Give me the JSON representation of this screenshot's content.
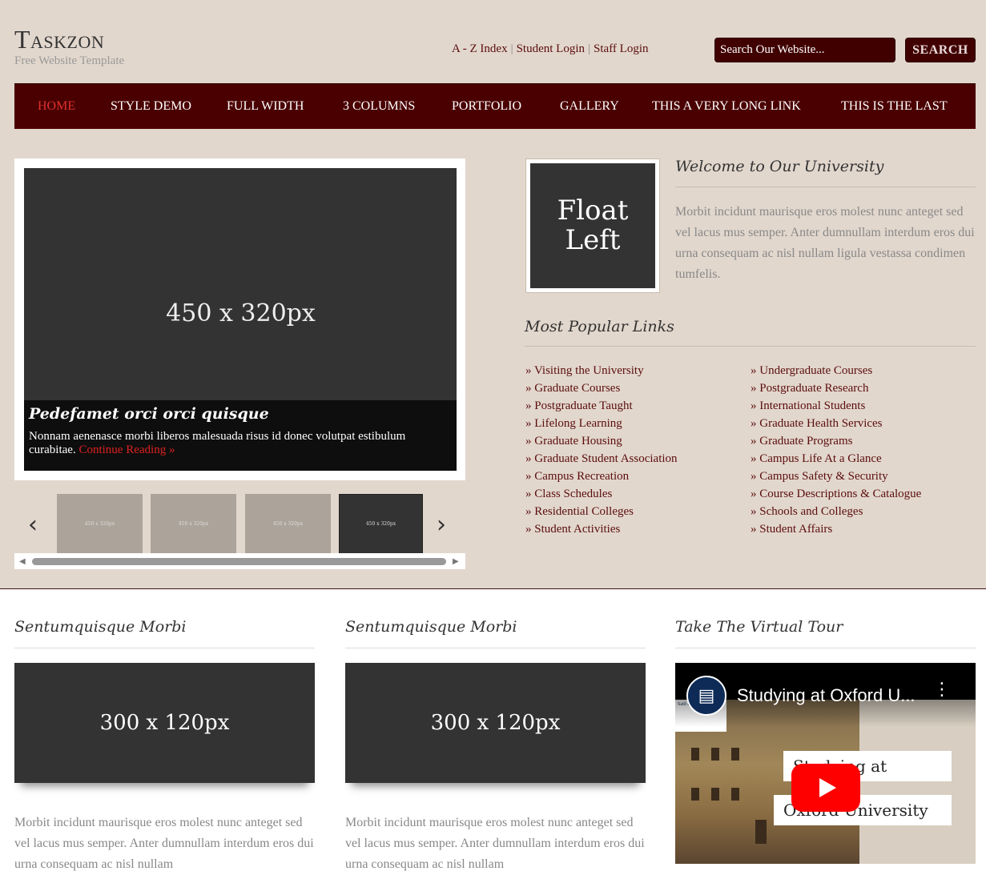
{
  "site": {
    "title": "Taskzon",
    "tagline": "Free Website Template"
  },
  "toplinks": [
    "A - Z Index",
    "Student Login",
    "Staff Login"
  ],
  "search": {
    "placeholder": "Search Our Website...",
    "button": "SEARCH"
  },
  "nav": [
    "Home",
    "Style Demo",
    "Full Width",
    "3 Columns",
    "Portfolio",
    "Gallery",
    "This A Very Long Link",
    "This Is The Last"
  ],
  "slider": {
    "image_label": "450 x 320px",
    "caption_title": "Pedefamet orci orci quisque",
    "caption_text": "Nonnam aenenasce morbi liberos malesuada risus id donec volutpat estibulum curabitae.",
    "caption_link": "Continue Reading »",
    "thumbs": [
      "450 x 320px",
      "450 x 320px",
      "450 x 320px",
      "450 x 320px"
    ],
    "prev_icon": "‹",
    "next_icon": "›"
  },
  "welcome": {
    "float_label": "Float Left",
    "title": "Welcome to Our University",
    "text": "Morbit incidunt maurisque eros molest nunc anteget sed vel lacus mus semper. Anter dumnullam interdum eros dui urna consequam ac nisl nullam ligula vestassa condimen tumfelis."
  },
  "popular": {
    "title": "Most Popular Links",
    "left": [
      "» Visiting the University",
      "» Graduate Courses",
      "» Postgraduate Taught",
      "» Lifelong Learning",
      "» Graduate Housing",
      "» Graduate Student Association",
      "» Campus Recreation",
      "» Class Schedules",
      "» Residential Colleges",
      "» Student Activities"
    ],
    "right": [
      "» Undergraduate Courses",
      "» Postgraduate Research",
      "» International Students",
      "» Graduate Health Services",
      "» Graduate Programs",
      "» Campus Life At a Glance",
      "» Campus Safety & Security",
      "» Course Descriptions & Catalogue",
      "» Schools and Colleges",
      "» Student Affairs"
    ]
  },
  "columns": [
    {
      "title": "Sentumquisque Morbi",
      "image_label": "300 x 120px",
      "text": "Morbit incidunt maurisque eros molest nunc anteget sed vel lacus mus semper. Anter dumnullam interdum eros dui urna consequam ac nisl nullam"
    },
    {
      "title": "Sentumquisque Morbi",
      "image_label": "300 x 120px",
      "text": "Morbit incidunt maurisque eros molest nunc anteget sed vel lacus mus semper. Anter dumnullam interdum eros dui urna consequam ac nisl nullam"
    }
  ],
  "tour": {
    "title": "Take The Virtual Tour",
    "video_title": "Studying at Oxford U...",
    "card1": "Studying at",
    "card2": "Oxford University",
    "badge": "Saïd Business School",
    "menu_icon": "⋮"
  },
  "colors": {
    "header_bg": "#e2d7cd",
    "nav_bg": "#4a0000",
    "accent": "#e02020",
    "link": "#5a0d0d"
  }
}
